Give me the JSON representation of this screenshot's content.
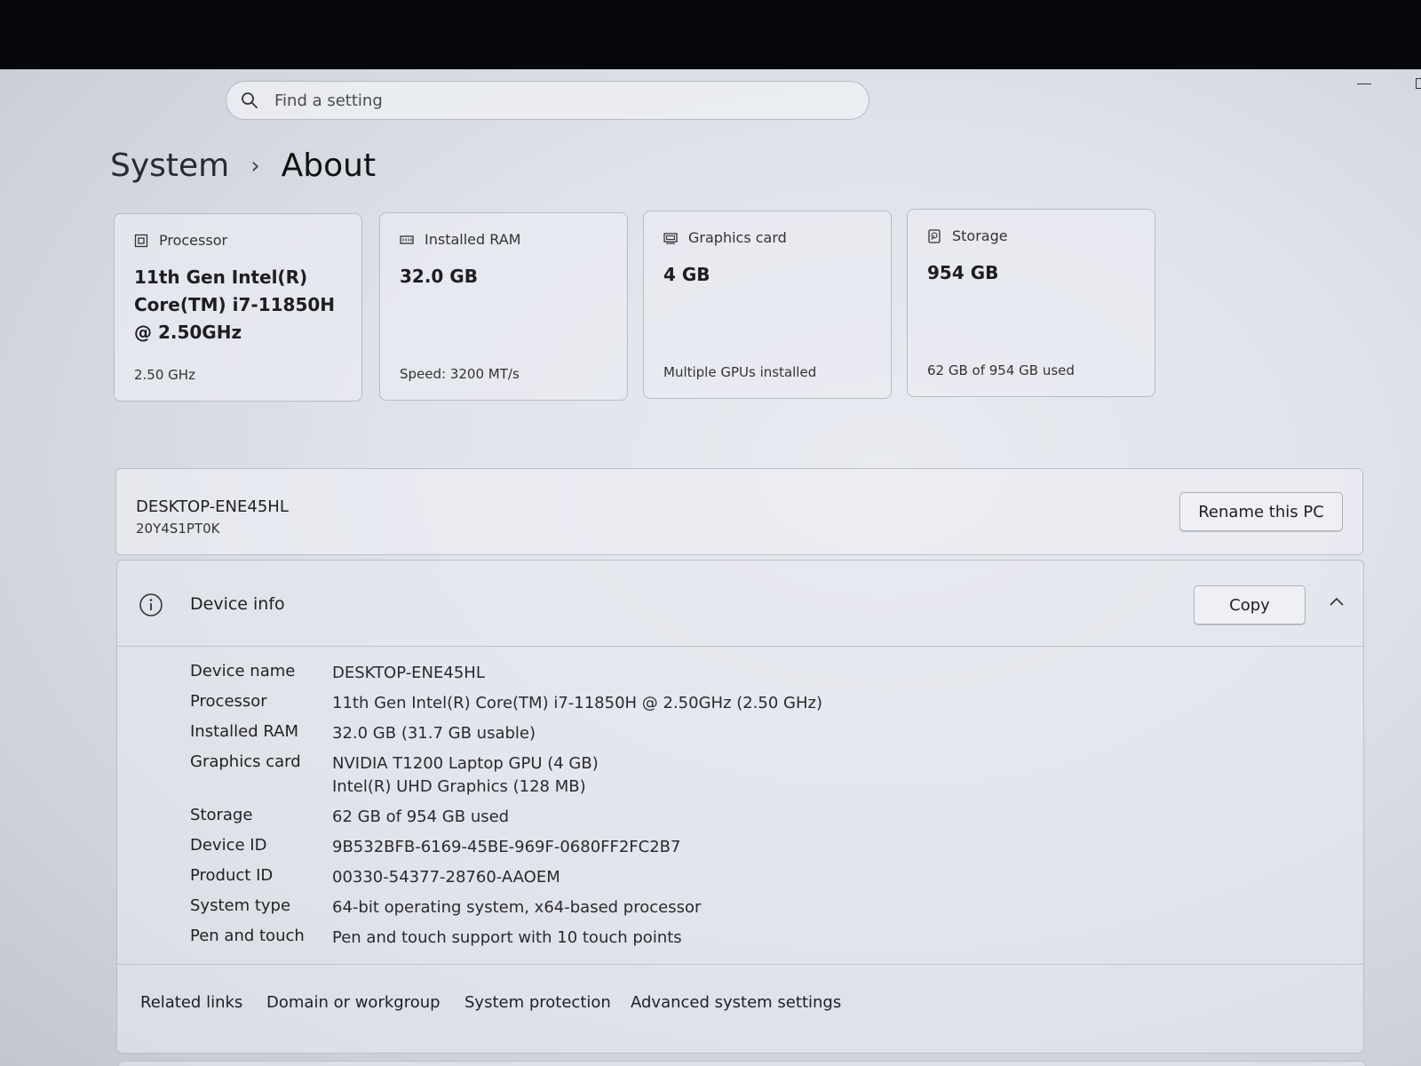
{
  "search": {
    "placeholder": "Find a setting"
  },
  "breadcrumb": {
    "parent": "System",
    "separator": "›",
    "current": "About"
  },
  "cards": {
    "processor": {
      "title": "Processor",
      "value": "11th Gen Intel(R) Core(TM) i7-11850H @ 2.50GHz",
      "sub": "2.50 GHz",
      "icon": "cpu-icon"
    },
    "ram": {
      "title": "Installed RAM",
      "value": "32.0 GB",
      "sub": "Speed: 3200 MT/s",
      "icon": "memory-icon"
    },
    "gpu": {
      "title": "Graphics card",
      "value": "4 GB",
      "sub": "Multiple GPUs installed",
      "icon": "gpu-icon"
    },
    "storage": {
      "title": "Storage",
      "value": "954 GB",
      "sub": "62 GB of 954 GB used",
      "icon": "storage-icon"
    }
  },
  "pc": {
    "name": "DESKTOP-ENE45HL",
    "model": "20Y4S1PT0K",
    "rename_label": "Rename this PC"
  },
  "device_info": {
    "title": "Device info",
    "copy_label": "Copy",
    "rows": [
      {
        "label": "Device name",
        "values": [
          "DESKTOP-ENE45HL"
        ]
      },
      {
        "label": "Processor",
        "values": [
          "11th Gen Intel(R) Core(TM) i7-11850H @ 2.50GHz (2.50 GHz)"
        ]
      },
      {
        "label": "Installed RAM",
        "values": [
          "32.0 GB (31.7 GB usable)"
        ]
      },
      {
        "label": "Graphics card",
        "values": [
          "NVIDIA T1200 Laptop GPU (4 GB)",
          "Intel(R) UHD Graphics (128 MB)"
        ]
      },
      {
        "label": "Storage",
        "values": [
          "62 GB of 954 GB used"
        ]
      },
      {
        "label": "Device ID",
        "values": [
          "9B532BFB-6169-45BE-969F-0680FF2FC2B7"
        ]
      },
      {
        "label": "Product ID",
        "values": [
          "00330-54377-28760-AAOEM"
        ]
      },
      {
        "label": "System type",
        "values": [
          "64-bit operating system, x64-based processor"
        ]
      },
      {
        "label": "Pen and touch",
        "values": [
          "Pen and touch support with 10 touch points"
        ]
      }
    ]
  },
  "related": {
    "title": "Related links",
    "links": [
      "Domain or workgroup",
      "System protection",
      "Advanced system settings"
    ]
  }
}
